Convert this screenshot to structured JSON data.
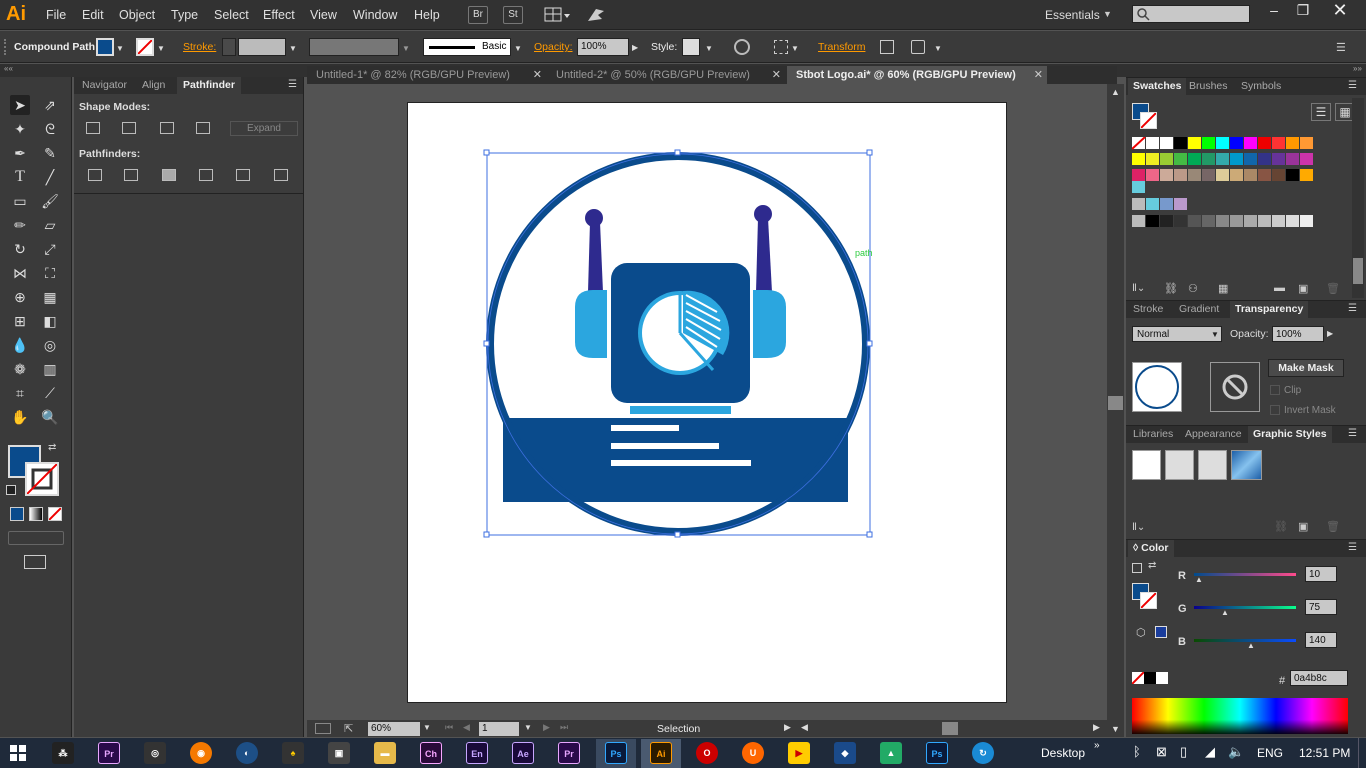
{
  "app": {
    "logo": "Ai",
    "workspace": "Essentials"
  },
  "menu": [
    "File",
    "Edit",
    "Object",
    "Type",
    "Select",
    "Effect",
    "View",
    "Window",
    "Help"
  ],
  "menu_buttons": [
    "Br",
    "St"
  ],
  "control": {
    "selection_type": "Compound Path",
    "stroke_label": "Stroke:",
    "brush_label": "Basic",
    "opacity_label": "Opacity:",
    "opacity_value": "100%",
    "style_label": "Style:",
    "transform_label": "Transform"
  },
  "left_panel": {
    "tabs": [
      "Navigator",
      "Align",
      "Pathfinder"
    ],
    "shape_modes_label": "Shape Modes:",
    "expand_label": "Expand",
    "pathfinders_label": "Pathfinders:"
  },
  "doc_tabs": [
    "Untitled-1* @ 82% (RGB/GPU Preview)",
    "Untitled-2* @ 50% (RGB/GPU Preview)",
    "Stbot Logo.ai* @ 60% (RGB/GPU Preview)"
  ],
  "canvas": {
    "path_hint": "path"
  },
  "status": {
    "zoom": "60%",
    "page": "1",
    "tool_name": "Selection"
  },
  "right_panel": {
    "swatches_tabs": [
      "Swatches",
      "Brushes",
      "Symbols"
    ],
    "transparency_tabs": [
      "Stroke",
      "Gradient",
      "Transparency"
    ],
    "blend_mode": "Normal",
    "opacity_label": "Opacity:",
    "opacity_value": "100%",
    "make_mask": "Make Mask",
    "clip": "Clip",
    "invert_mask": "Invert Mask",
    "styles_tabs": [
      "Libraries",
      "Appearance",
      "Graphic Styles"
    ],
    "color_title": "Color",
    "r_label": "R",
    "g_label": "G",
    "b_label": "B",
    "r_value": "10",
    "g_value": "75",
    "b_value": "140",
    "hex_label": "#",
    "hex_value": "0a4b8c"
  },
  "taskbar": {
    "apps": [
      "Pr",
      "Ch",
      "En",
      "Ae",
      "Pr",
      "Ps",
      "Ai",
      "Ps"
    ],
    "desktop": "Desktop",
    "lang": "ENG",
    "time": "12:51 PM"
  },
  "colors": {
    "fill": "#0a4b8c",
    "light_blue": "#2ba6df",
    "accent_orange": "#ff9a00",
    "antenna": "#2e2a8e"
  }
}
